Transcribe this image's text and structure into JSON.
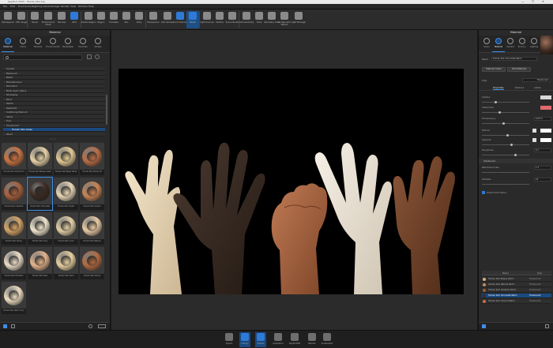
{
  "window": {
    "title": "KeyShot 2023 - Hands_Skin.bip",
    "controls": [
      "—",
      "☐",
      "✕"
    ]
  },
  "menu": [
    "File",
    "Edit",
    "Environment",
    "Lighting",
    "Camera",
    "Image",
    "Render",
    "View",
    "Window",
    "Help"
  ],
  "ribbon": [
    {
      "label": "Workspaces",
      "icon": "workspaces-icon"
    },
    {
      "label": "CPU Usage",
      "icon": "cpu-icon"
    },
    {
      "label": "Pause",
      "icon": "pause-icon"
    },
    {
      "label": "Performance Mode",
      "icon": "performance-icon"
    },
    {
      "label": "Denoise",
      "icon": "denoise-icon"
    },
    {
      "label": "GPU",
      "icon": "gpu-icon"
    },
    {
      "label": "Render Region",
      "icon": "region-icon"
    },
    {
      "label": "Region",
      "icon": "crop-icon"
    },
    {
      "label": "Translate",
      "icon": "move-icon"
    },
    {
      "label": "Pan",
      "icon": "pan-icon"
    },
    {
      "label": "Dolly",
      "icon": "dolly-icon"
    },
    {
      "label": "Perspective",
      "icon": "perspective-icon"
    },
    {
      "label": "Add Camera",
      "icon": "camera-icon"
    },
    {
      "label": "Lock Camera",
      "icon": "lock-icon"
    },
    {
      "label": "Reset",
      "icon": "reset-icon"
    },
    {
      "label": "Light Sources",
      "icon": "light-icon"
    },
    {
      "label": "Studios",
      "icon": "studio-icon"
    },
    {
      "label": "Scene Nodes",
      "icon": "nodes-icon"
    },
    {
      "label": "Add Geometry",
      "icon": "geometry-icon"
    },
    {
      "label": "Tools",
      "icon": "tools-icon"
    },
    {
      "label": "Geometry View",
      "icon": "geometry-view-icon"
    },
    {
      "label": "Configurator Wizard",
      "icon": "wizard-icon"
    },
    {
      "label": "Light Manager",
      "icon": "light-manager-icon"
    }
  ],
  "left_panel": {
    "title": "Material",
    "tabs": [
      "Materials",
      "Colors",
      "Textures",
      "Environments",
      "Backplates",
      "Favorites",
      "Models"
    ],
    "tree": [
      {
        "label": "Liquids",
        "child": false
      },
      {
        "label": "Measured",
        "child": false
      },
      {
        "label": "Metal",
        "child": false
      },
      {
        "label": "Miscellaneous",
        "child": false
      },
      {
        "label": "Mold-Tech",
        "child": false
      },
      {
        "label": "Multi Layer Optics",
        "child": false
      },
      {
        "label": "Packaging",
        "child": false
      },
      {
        "label": "Paint",
        "child": false
      },
      {
        "label": "Plastic",
        "child": false
      },
      {
        "label": "RealCloth",
        "child": false
      },
      {
        "label": "Scattering Medium",
        "child": false
      },
      {
        "label": "Stone",
        "child": false
      },
      {
        "label": "Toon",
        "child": false
      },
      {
        "label": "Translucent",
        "child": false
      },
      {
        "label": "Human Skin Green",
        "child": true,
        "selected": true
      },
      {
        "label": "Wood",
        "child": false
      }
    ],
    "materials": [
      {
        "label": "Human Skin Almond Oil",
        "color": "#c9713f"
      },
      {
        "label": "Human Skin Bisque Green",
        "color": "#e6d1a6"
      },
      {
        "label": "Human Skin Beige Yellow",
        "color": "#e2c892"
      },
      {
        "label": "Human Skin Brown Oil",
        "color": "#b86d45"
      },
      {
        "label": "Human Skin Chestnut",
        "color": "#a65f3c"
      },
      {
        "label": "Human Skin Chocolate",
        "color": "#3b2a21",
        "selected": true
      },
      {
        "label": "Human Skin Cream",
        "color": "#e9d7b5"
      },
      {
        "label": "Human Skin Golden",
        "color": "#c88251"
      },
      {
        "label": "Human Skin Honey",
        "color": "#d4a263"
      },
      {
        "label": "Human Skin Ivory",
        "color": "#efe4cc"
      },
      {
        "label": "Human Skin Linen",
        "color": "#e3cfa5"
      },
      {
        "label": "Human Skin Natural",
        "color": "#e8c9a3"
      },
      {
        "label": "Human Skin Porcelain",
        "color": "#eadbc6"
      },
      {
        "label": "Human Skin Rose",
        "color": "#e3b38a"
      },
      {
        "label": "Human Skin Sand",
        "color": "#e6cf9e"
      },
      {
        "label": "Human Skin Sienna",
        "color": "#b16a3f"
      },
      {
        "label": "Human Skin Warm Ivory",
        "color": "#ecdcbf"
      }
    ]
  },
  "right_panel": {
    "title": "Material",
    "tabs": [
      "Scene",
      "Material",
      "Camera",
      "Environ.",
      "Lighting",
      "Image"
    ],
    "name_label": "Name",
    "name_value": "Human Skin Chocolate Warm",
    "buttons": [
      "Material Graph",
      "Multi-Material"
    ],
    "type_label": "Type",
    "type_value": "Translucent",
    "subtabs": [
      "Properties",
      "Textures",
      "Labels"
    ],
    "props": [
      {
        "label": "Surface",
        "value": "",
        "kind": "swatch",
        "color": "#d7d7d7"
      },
      {
        "label": "Subsurface",
        "value": "",
        "kind": "swatch",
        "color": "#e06b6b"
      },
      {
        "label": "Translucency",
        "value": "0.05 m",
        "kind": "field"
      },
      {
        "label": "Texture",
        "value": "",
        "kind": "swatch2",
        "color": "#ffffff"
      },
      {
        "label": "Specular",
        "value": "",
        "kind": "swatch2",
        "color": "#ffffff"
      },
      {
        "label": "Roughness",
        "value": "0.1",
        "kind": "field"
      }
    ],
    "advanced_label": "Advanced",
    "adv_props": [
      {
        "label": "Refractive Index",
        "value": "1.3"
      },
      {
        "label": "Samples",
        "value": "16"
      }
    ],
    "checkbox_label": "Global Illumination",
    "library_header": [
      "Name",
      "Type"
    ],
    "library": [
      {
        "label": "Human Skin Bisque Warm",
        "type": "Translucent",
        "color": "#d8b084"
      },
      {
        "label": "Human Skin Natural Warm",
        "type": "Translucent",
        "color": "#c58a5f"
      },
      {
        "label": "Human Skin Chestnut Warm",
        "type": "Translucent",
        "color": "#9b5b38"
      },
      {
        "label": "Human Skin Chocolate Warm",
        "type": "Translucent",
        "color": "#3b2a21",
        "selected": true
      },
      {
        "label": "Human Skin Almond Warm",
        "type": "Translucent",
        "color": "#c9713f"
      }
    ]
  },
  "bottom_bar": [
    {
      "label": "Import",
      "icon": "import-icon"
    },
    {
      "label": "Library",
      "icon": "library-icon",
      "active": true
    },
    {
      "label": "Project",
      "icon": "project-icon",
      "active": true
    },
    {
      "label": "Animation",
      "icon": "animation-icon"
    },
    {
      "label": "KeyShotXR",
      "icon": "keyshotxr-icon"
    },
    {
      "label": "Render",
      "icon": "render-icon"
    },
    {
      "label": "Screenshot",
      "icon": "screenshot-icon"
    }
  ]
}
